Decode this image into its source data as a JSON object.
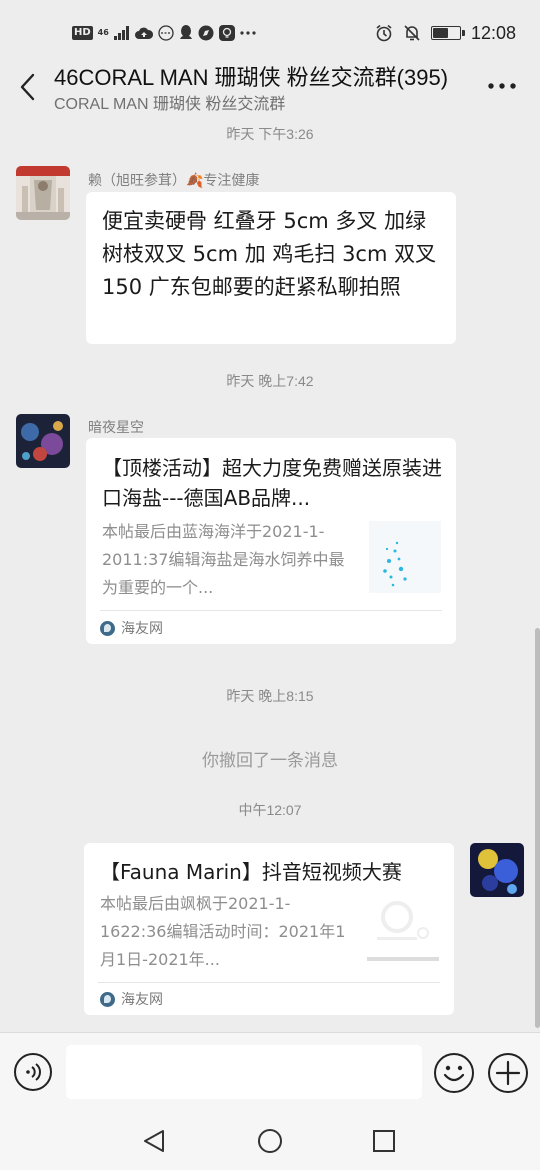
{
  "status_bar": {
    "hd": "HD",
    "network": "46",
    "time": "12:08",
    "battery_level": 0.6
  },
  "header": {
    "title": "46CORAL MAN 珊瑚侠 粉丝交流群(395)",
    "subtitle": "CORAL MAN 珊瑚侠 粉丝交流群",
    "back_icon": "chevron-left-icon",
    "more_icon": "more-dots-icon"
  },
  "chat": {
    "time_1": "昨天 下午3:26",
    "msg_1": {
      "sender": "赖（旭旺参茸）🍂专注健康",
      "text": "便宜卖硬骨 红叠牙 5cm 多叉 加绿树枝双叉 5cm 加 鸡毛扫 3cm 双叉  150 广东包邮要的赶紧私聊拍照"
    },
    "time_2": "昨天 晚上7:42",
    "msg_2": {
      "sender": "暗夜星空",
      "card_title": "【顶楼活动】超大力度免费赠送原装进口海盐---德国AB品牌...",
      "card_desc": "本帖最后由蓝海海洋于2021-1-2011:37编辑海盐是海水饲养中最为重要的一个...",
      "source": "海友网"
    },
    "time_3": "昨天 晚上8:15",
    "recall_text": "你撤回了一条消息",
    "time_4": "中午12:07",
    "msg_3": {
      "card_title": "【Fauna Marin】抖音短视频大赛",
      "card_desc": "本帖最后由飒枫于2021-1-1622:36编辑活动时间：2021年1月1日-2021年...",
      "source": "海友网"
    }
  },
  "input_bar": {
    "placeholder": "",
    "voice_icon": "voice-icon",
    "emoji_icon": "emoji-icon",
    "plus_icon": "plus-icon"
  },
  "nav": {
    "back_icon": "nav-back-icon",
    "home_icon": "nav-home-icon",
    "recents_icon": "nav-recents-icon"
  }
}
